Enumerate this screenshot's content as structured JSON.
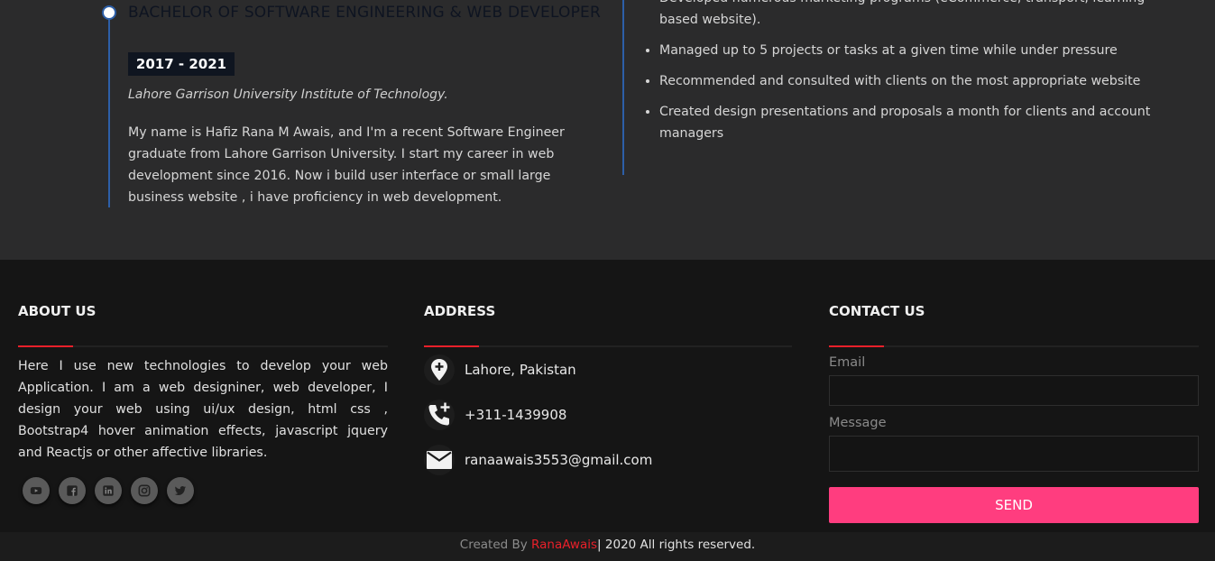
{
  "education": {
    "title": "BACHELOR OF SOFTWARE ENGINEERING & WEB DEVELOPER",
    "years": "2017 - 2021",
    "school": "Lahore Garrison University Institute of Technology.",
    "bio": "My name is Hafiz Rana M Awais, and I'm a recent Software Engineer graduate from Lahore Garrison University. I start my career in web development since 2016. Now i build user interface or small large business website , i have proficiency in web development."
  },
  "experience": {
    "items": [
      "Developed numerous marketing programs (eCommerce, transport, learning based website).",
      "Managed up to 5 projects or tasks at a given time while under pressure",
      "Recommended and consulted with clients on the most appropriate website",
      "Created design presentations and proposals a month for clients and account managers"
    ]
  },
  "footer": {
    "about": {
      "heading": "ABOUT US",
      "text": "Here I use new technologies to develop your web Application. I am a web designiner, web developer, I design your web using ui/ux design, html css , Bootstrap4 hover animation effects, javascript jquery and Reactjs or other affective libraries.",
      "socials": [
        "youtube-icon",
        "facebook-icon",
        "linkedin-icon",
        "instagram-icon",
        "twitter-icon"
      ]
    },
    "address": {
      "heading": "ADDRESS",
      "location": "Lahore, Pakistan",
      "phone": "+311-1439908",
      "email": "ranaawais3553@gmail.com"
    },
    "contact": {
      "heading": "CONTACT US",
      "email_label": "Email",
      "email_value": "",
      "message_label": "Message",
      "message_value": "",
      "send_label": "SEND"
    },
    "copyright": {
      "prefix": "Created By",
      "author": "RanaAwais",
      "separator": "|",
      "rights": "2020 All rights reserved."
    }
  },
  "colors": {
    "accent_red": "#e8202a",
    "send_button": "#ff3d7f",
    "timeline_blue": "#2d5fa8"
  }
}
